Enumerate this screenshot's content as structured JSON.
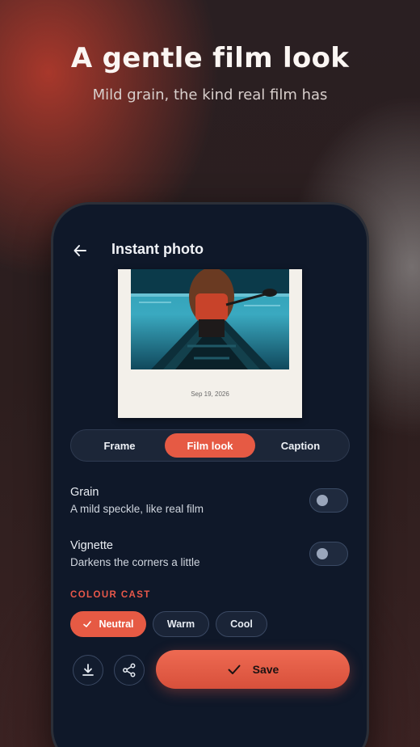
{
  "hero": {
    "headline": "A gentle film look",
    "subhead": "Mild grain, the kind real film has"
  },
  "app": {
    "title": "Instant photo",
    "back_icon": "arrow-left-icon"
  },
  "preview": {
    "date": "Sep 19, 2026"
  },
  "tabs": [
    {
      "label": "Frame",
      "active": false
    },
    {
      "label": "Film look",
      "active": true
    },
    {
      "label": "Caption",
      "active": false
    }
  ],
  "settings": {
    "grain": {
      "label": "Grain",
      "description": "A mild speckle, like real film",
      "enabled": false
    },
    "vignette": {
      "label": "Vignette",
      "description": "Darkens the corners a little",
      "enabled": false
    }
  },
  "colour_cast": {
    "label": "COLOUR CAST",
    "options": [
      {
        "label": "Neutral",
        "selected": true
      },
      {
        "label": "Warm",
        "selected": false
      },
      {
        "label": "Cool",
        "selected": false
      }
    ]
  },
  "actions": {
    "download_icon": "download-icon",
    "share_icon": "share-icon",
    "save_label": "Save",
    "save_icon": "check-icon"
  },
  "colors": {
    "accent": "#e65a44",
    "background": "#0f1829"
  }
}
